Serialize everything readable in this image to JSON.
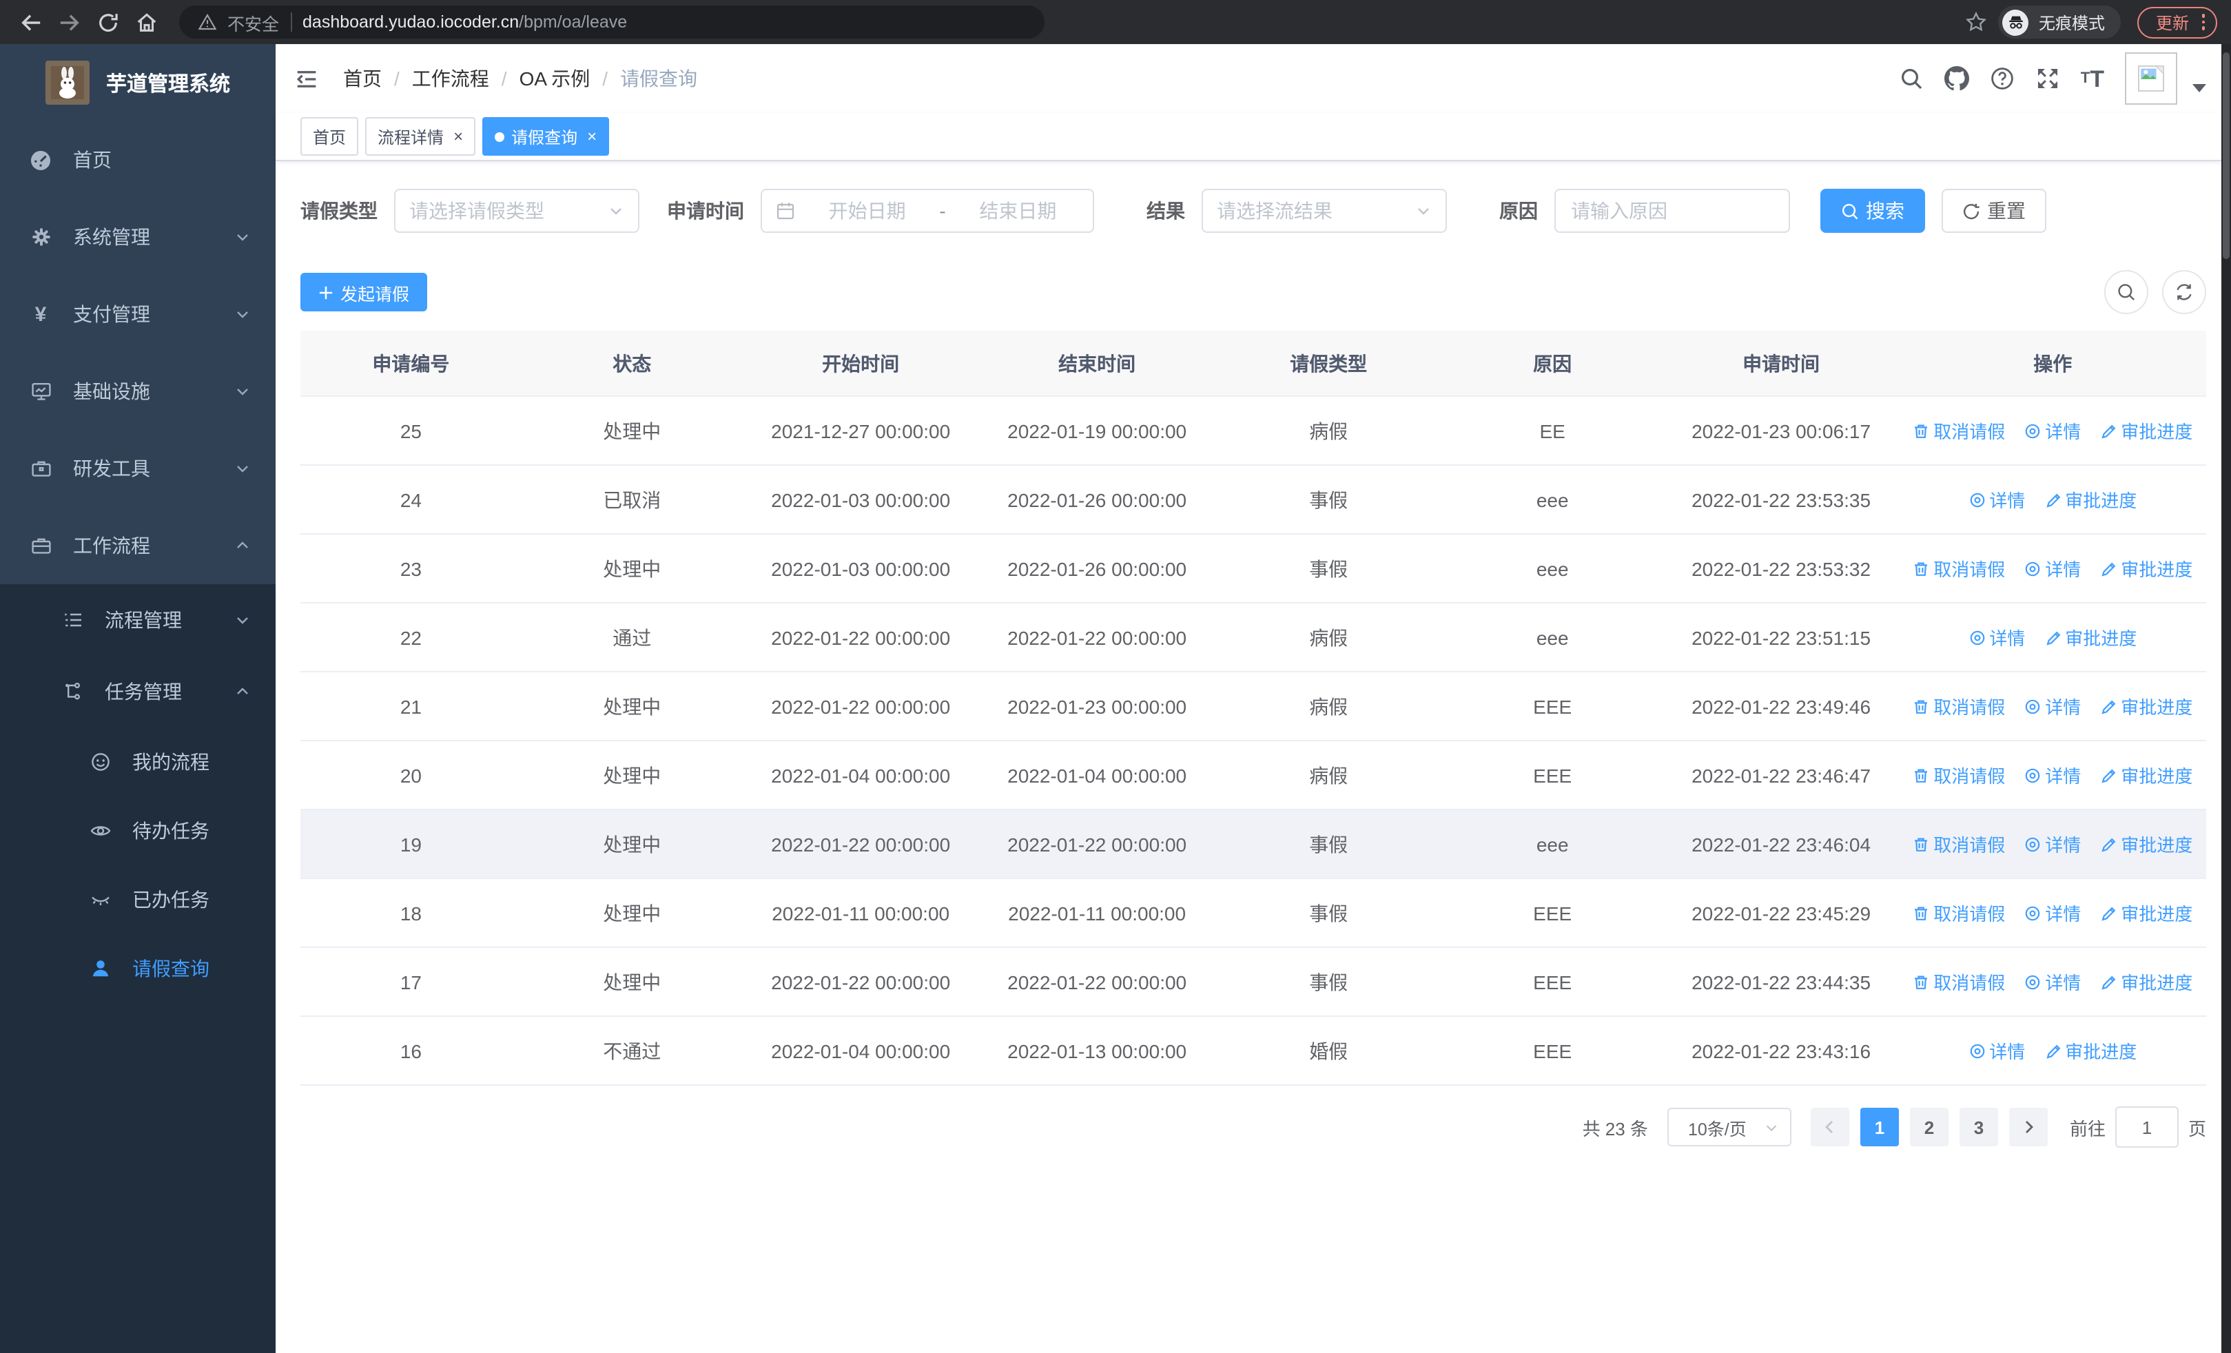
{
  "browser": {
    "security_label": "不安全",
    "url_host": "dashboard.yudao.iocoder.cn",
    "url_path": "/bpm/oa/leave",
    "incognito_label": "无痕模式",
    "update_label": "更新"
  },
  "ui": {
    "close": "×",
    "breadcrumb_separator": "/"
  },
  "sidebar": {
    "title": "芋道管理系统",
    "items": [
      {
        "icon": "dashboard-icon",
        "label": "首页"
      },
      {
        "icon": "gear-icon",
        "label": "系统管理",
        "chevron": "down"
      },
      {
        "icon": "yen-icon",
        "label": "支付管理",
        "chevron": "down"
      },
      {
        "icon": "monitor-icon",
        "label": "基础设施",
        "chevron": "down"
      },
      {
        "icon": "toolbox-icon",
        "label": "研发工具",
        "chevron": "down"
      },
      {
        "icon": "briefcase-icon",
        "label": "工作流程",
        "chevron": "up",
        "children": [
          {
            "icon": "list-icon",
            "label": "流程管理",
            "chevron": "down"
          },
          {
            "icon": "tree-icon",
            "label": "任务管理",
            "chevron": "up",
            "children": [
              {
                "icon": "face-icon",
                "label": "我的流程"
              },
              {
                "icon": "eye-open-icon",
                "label": "待办任务"
              },
              {
                "icon": "eye-closed-icon",
                "label": "已办任务"
              },
              {
                "icon": "user-icon",
                "label": "请假查询",
                "active": true
              }
            ]
          }
        ]
      }
    ]
  },
  "breadcrumb": [
    "首页",
    "工作流程",
    "OA 示例",
    "请假查询"
  ],
  "tabs": [
    {
      "label": "首页",
      "closable": false,
      "active": false
    },
    {
      "label": "流程详情",
      "closable": true,
      "active": false
    },
    {
      "label": "请假查询",
      "closable": true,
      "active": true
    }
  ],
  "filters": {
    "type_label": "请假类型",
    "type_placeholder": "请选择请假类型",
    "time_label": "申请时间",
    "start_placeholder": "开始日期",
    "range_separator": "-",
    "end_placeholder": "结束日期",
    "result_label": "结果",
    "result_placeholder": "请选择流结果",
    "reason_label": "原因",
    "reason_placeholder": "请输入原因",
    "search_label": "搜索",
    "reset_label": "重置"
  },
  "toolbar": {
    "create_label": "发起请假"
  },
  "table": {
    "columns": [
      "申请编号",
      "状态",
      "开始时间",
      "结束时间",
      "请假类型",
      "原因",
      "申请时间",
      "操作"
    ],
    "action_labels": {
      "cancel": "取消请假",
      "detail": "详情",
      "progress": "审批进度"
    },
    "rows": [
      {
        "id": "25",
        "status": "处理中",
        "start": "2021-12-27 00:00:00",
        "end": "2022-01-19 00:00:00",
        "type": "病假",
        "reason": "EE",
        "apply_time": "2022-01-23 00:06:17",
        "actions": [
          "cancel",
          "detail",
          "progress"
        ],
        "highlight": false
      },
      {
        "id": "24",
        "status": "已取消",
        "start": "2022-01-03 00:00:00",
        "end": "2022-01-26 00:00:00",
        "type": "事假",
        "reason": "eee",
        "apply_time": "2022-01-22 23:53:35",
        "actions": [
          "detail",
          "progress"
        ],
        "highlight": false
      },
      {
        "id": "23",
        "status": "处理中",
        "start": "2022-01-03 00:00:00",
        "end": "2022-01-26 00:00:00",
        "type": "事假",
        "reason": "eee",
        "apply_time": "2022-01-22 23:53:32",
        "actions": [
          "cancel",
          "detail",
          "progress"
        ],
        "highlight": false
      },
      {
        "id": "22",
        "status": "通过",
        "start": "2022-01-22 00:00:00",
        "end": "2022-01-22 00:00:00",
        "type": "病假",
        "reason": "eee",
        "apply_time": "2022-01-22 23:51:15",
        "actions": [
          "detail",
          "progress"
        ],
        "highlight": false
      },
      {
        "id": "21",
        "status": "处理中",
        "start": "2022-01-22 00:00:00",
        "end": "2022-01-23 00:00:00",
        "type": "病假",
        "reason": "EEE",
        "apply_time": "2022-01-22 23:49:46",
        "actions": [
          "cancel",
          "detail",
          "progress"
        ],
        "highlight": false
      },
      {
        "id": "20",
        "status": "处理中",
        "start": "2022-01-04 00:00:00",
        "end": "2022-01-04 00:00:00",
        "type": "病假",
        "reason": "EEE",
        "apply_time": "2022-01-22 23:46:47",
        "actions": [
          "cancel",
          "detail",
          "progress"
        ],
        "highlight": false
      },
      {
        "id": "19",
        "status": "处理中",
        "start": "2022-01-22 00:00:00",
        "end": "2022-01-22 00:00:00",
        "type": "事假",
        "reason": "eee",
        "apply_time": "2022-01-22 23:46:04",
        "actions": [
          "cancel",
          "detail",
          "progress"
        ],
        "highlight": true
      },
      {
        "id": "18",
        "status": "处理中",
        "start": "2022-01-11 00:00:00",
        "end": "2022-01-11 00:00:00",
        "type": "事假",
        "reason": "EEE",
        "apply_time": "2022-01-22 23:45:29",
        "actions": [
          "cancel",
          "detail",
          "progress"
        ],
        "highlight": false
      },
      {
        "id": "17",
        "status": "处理中",
        "start": "2022-01-22 00:00:00",
        "end": "2022-01-22 00:00:00",
        "type": "事假",
        "reason": "EEE",
        "apply_time": "2022-01-22 23:44:35",
        "actions": [
          "cancel",
          "detail",
          "progress"
        ],
        "highlight": false
      },
      {
        "id": "16",
        "status": "不通过",
        "start": "2022-01-04 00:00:00",
        "end": "2022-01-13 00:00:00",
        "type": "婚假",
        "reason": "EEE",
        "apply_time": "2022-01-22 23:43:16",
        "actions": [
          "detail",
          "progress"
        ],
        "highlight": false
      }
    ]
  },
  "pagination": {
    "total_text": "共 23 条",
    "page_size": "10条/页",
    "pages": [
      "1",
      "2",
      "3"
    ],
    "active_page": "1",
    "goto_label": "前往",
    "goto_value": "1",
    "goto_suffix": "页"
  },
  "colors": {
    "accent": "#409eff",
    "sidebar_bg": "#304156",
    "submenu_bg": "#1f2d3d",
    "header_bg": "#f8f8f9"
  }
}
